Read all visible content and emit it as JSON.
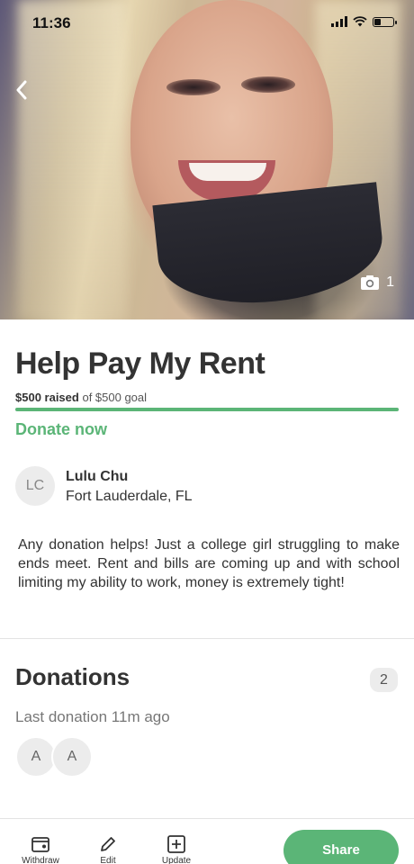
{
  "status_bar": {
    "time": "11:36",
    "icons": [
      "signal-icon",
      "wifi-icon",
      "battery-icon"
    ]
  },
  "hero": {
    "photo_count": "1",
    "back_icon": "chevron-left-icon",
    "camera_icon": "camera-icon"
  },
  "campaign": {
    "title": "Help Pay My Rent",
    "raised_amount": "$500 raised",
    "goal_text": "of $500 goal",
    "progress_fraction": 1.0,
    "donate_label": "Donate now"
  },
  "organizer": {
    "initials": "LC",
    "name": "Lulu Chu",
    "location": "Fort Lauderdale, FL"
  },
  "story": "Any donation helps! Just a college girl struggling to make ends meet. Rent and bills are coming up and with school limiting my ability to work, money is extremely tight!",
  "donations": {
    "title": "Donations",
    "count": "2",
    "last_donation": "Last donation 11m ago",
    "donors": [
      "A",
      "A"
    ]
  },
  "bottom_bar": {
    "tools": [
      {
        "label": "Withdraw",
        "icon": "withdraw-icon"
      },
      {
        "label": "Edit",
        "icon": "pencil-icon"
      },
      {
        "label": "Update",
        "icon": "plus-square-icon"
      }
    ],
    "share_label": "Share"
  },
  "colors": {
    "accent": "#5bb577",
    "text": "#333333",
    "muted": "#777777"
  }
}
